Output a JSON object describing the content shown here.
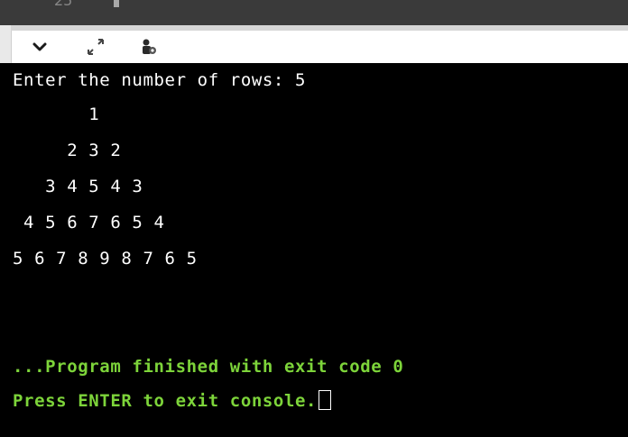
{
  "top": {
    "partial_line_number": "25"
  },
  "toolbar": {
    "icons": [
      "chevron-down-icon",
      "expand-icon",
      "debug-settings-icon"
    ]
  },
  "console": {
    "prompt": "Enter the number of rows: 5",
    "pyramid": [
      "       1",
      "     2 3 2",
      "   3 4 5 4 3",
      " 4 5 6 7 6 5 4",
      "5 6 7 8 9 8 7 6 5"
    ],
    "finished": "...Program finished with exit code 0",
    "press_enter": "Press ENTER to exit console."
  },
  "colors": {
    "background": "#000000",
    "output_text": "#ffffff",
    "status_text": "#7dd43a"
  }
}
